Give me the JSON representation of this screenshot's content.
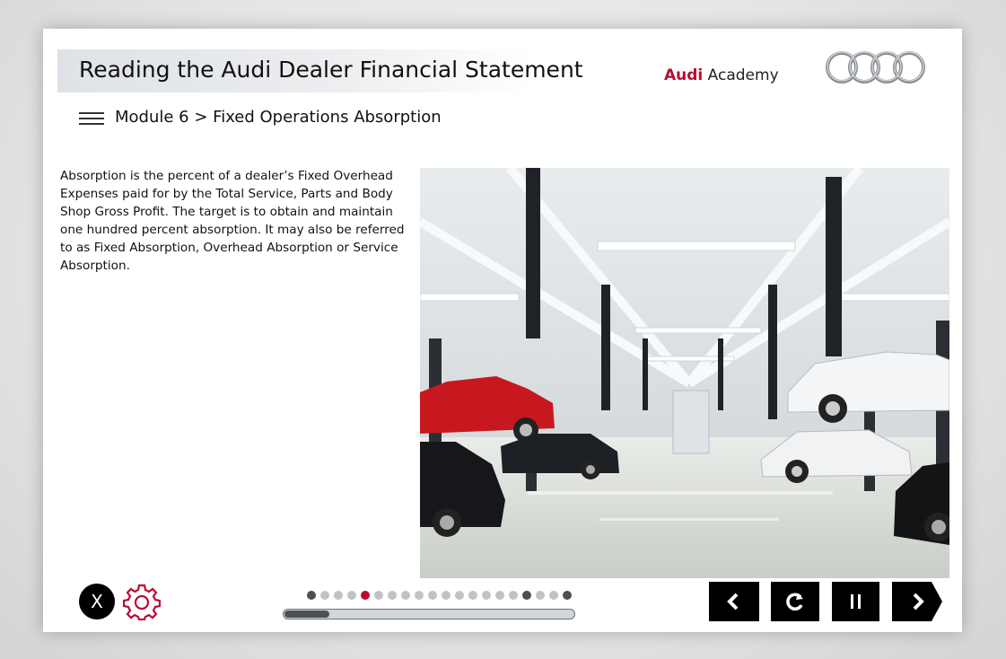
{
  "header": {
    "title": "Reading the Audi Dealer Financial Statement",
    "brand_audi": "Audi",
    "brand_academy": " Academy",
    "logo_icon": "audi-four-rings-icon"
  },
  "breadcrumb": {
    "text": "Module 6 > Fixed Operations Absorption",
    "menu_icon": "hamburger-menu-icon"
  },
  "content": {
    "paragraph": "Absorption is the percent of a dealer’s Fixed Overhead Expenses paid for by the Total Service, Parts and Body Shop Gross Profit. The target is to obtain and maintain one hundred percent absorption. It may also be referred to as Fixed Absorption, Overhead Absorption or Service Absorption.",
    "image_subject": "service-workshop-photo"
  },
  "footer": {
    "close_label": "X",
    "settings_icon": "gear-icon",
    "slide_dots": [
      "dark",
      "light",
      "light",
      "light",
      "active",
      "light",
      "light",
      "light",
      "light",
      "light",
      "light",
      "light",
      "light",
      "light",
      "light",
      "light",
      "dark",
      "light",
      "light",
      "dark"
    ],
    "progress_fraction": 0.15,
    "nav": {
      "prev_icon": "chevron-left-icon",
      "replay_icon": "replay-icon",
      "pause_icon": "pause-icon",
      "next_icon": "chevron-right-icon"
    }
  },
  "colors": {
    "accent_red": "#bb0a30",
    "dot_dark": "#4a4f55",
    "dot_light": "#bfc3c7",
    "button_black": "#000000"
  }
}
